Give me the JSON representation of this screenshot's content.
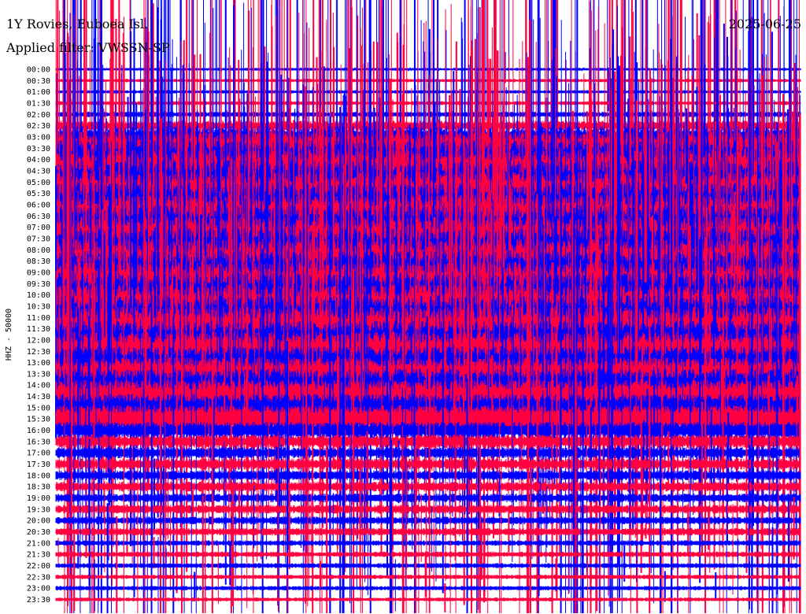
{
  "header": {
    "station": "1Y Rovies, Euboea Isl.",
    "filter": "Applied filter: VWSSN-SP",
    "date": "2025-06-25"
  },
  "chart_data": {
    "type": "line",
    "subtype": "helicorder",
    "title": "1Y Rovies, Euboea Isl.",
    "ylabel": "HHZ - 50000",
    "xlabel": "",
    "colors": [
      "#0000ff",
      "#ff0040"
    ],
    "row_labels": [
      "00:00",
      "00:30",
      "01:00",
      "01:30",
      "02:00",
      "02:30",
      "03:00",
      "03:30",
      "04:00",
      "04:30",
      "05:00",
      "05:30",
      "06:00",
      "06:30",
      "07:00",
      "07:30",
      "08:00",
      "08:30",
      "09:00",
      "09:30",
      "10:00",
      "10:30",
      "11:00",
      "11:30",
      "12:00",
      "12:30",
      "13:00",
      "13:30",
      "14:00",
      "14:30",
      "15:00",
      "15:30",
      "16:00",
      "16:30",
      "17:00",
      "17:30",
      "18:00",
      "18:30",
      "19:00",
      "19:30",
      "20:00",
      "20:30",
      "21:00",
      "21:30",
      "22:00",
      "22:30",
      "23:00",
      "23:30"
    ],
    "relative_amplitude": [
      0.25,
      0.3,
      0.3,
      0.35,
      0.5,
      0.9,
      2,
      3,
      3.5,
      4,
      4,
      4,
      4,
      4,
      4,
      4,
      4,
      4,
      4,
      4,
      4,
      4,
      4,
      4,
      3.5,
      3.5,
      3,
      3,
      3,
      3,
      2.5,
      2.5,
      1.5,
      1.2,
      1.0,
      1.0,
      0.9,
      0.9,
      0.8,
      0.8,
      0.7,
      0.7,
      0.5,
      0.5,
      0.45,
      0.4,
      0.4,
      0.35
    ]
  }
}
